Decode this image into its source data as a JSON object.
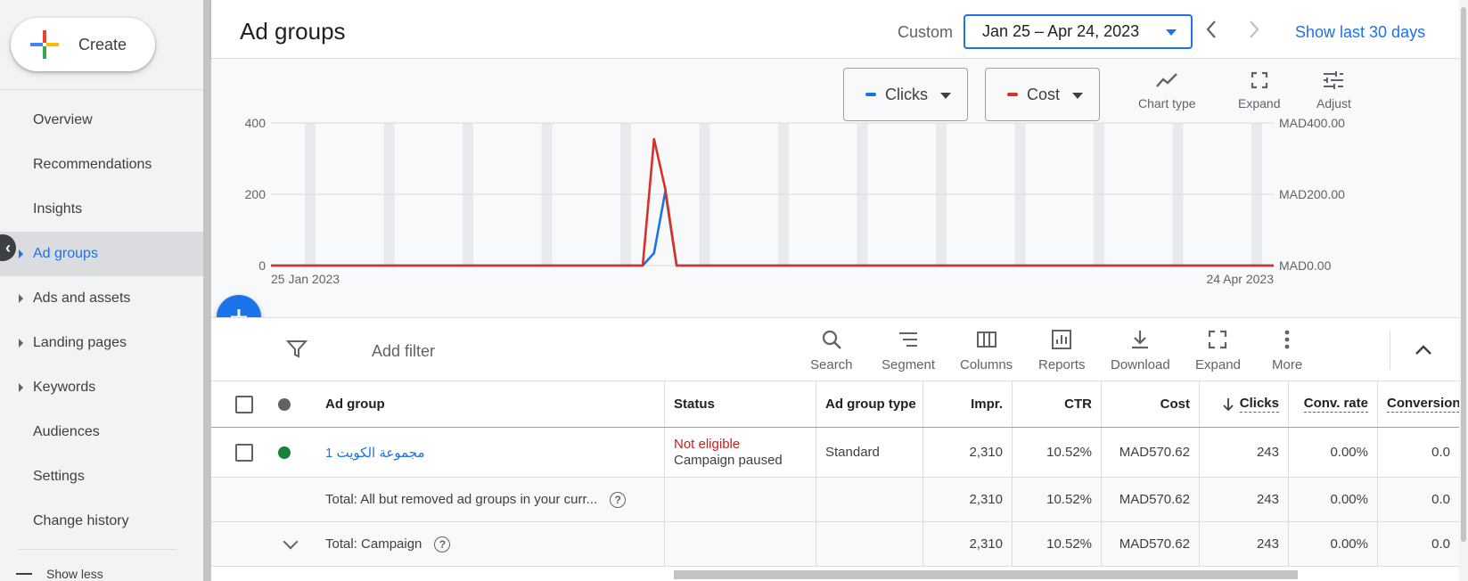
{
  "sidebar": {
    "create_label": "Create",
    "items": [
      {
        "label": "Overview",
        "expandable": false,
        "active": false
      },
      {
        "label": "Recommendations",
        "expandable": false,
        "active": false
      },
      {
        "label": "Insights",
        "expandable": false,
        "active": false
      },
      {
        "label": "Ad groups",
        "expandable": true,
        "active": true
      },
      {
        "label": "Ads and assets",
        "expandable": true,
        "active": false
      },
      {
        "label": "Landing pages",
        "expandable": true,
        "active": false
      },
      {
        "label": "Keywords",
        "expandable": true,
        "active": false
      },
      {
        "label": "Audiences",
        "expandable": false,
        "active": false
      },
      {
        "label": "Settings",
        "expandable": false,
        "active": false
      },
      {
        "label": "Change history",
        "expandable": false,
        "active": false
      }
    ],
    "show_less": "Show less"
  },
  "header": {
    "title": "Ad groups",
    "custom_label": "Custom",
    "date_range": "Jan 25 – Apr 24, 2023",
    "show_last": "Show last 30 days"
  },
  "chart_controls": {
    "metric1": "Clicks",
    "metric2": "Cost",
    "chart_type": "Chart type",
    "expand": "Expand",
    "adjust": "Adjust"
  },
  "chart_data": {
    "type": "line",
    "x_start_label": "25 Jan 2023",
    "x_end_label": "24 Apr 2023",
    "y_left_ticks": [
      "0",
      "200",
      "400"
    ],
    "y_right_ticks": [
      "MAD0.00",
      "MAD200.00",
      "MAD400.00"
    ],
    "ylim_left": [
      0,
      400
    ],
    "ylim_right": [
      0,
      400
    ],
    "series": [
      {
        "name": "Clicks",
        "color": "#1a73e8",
        "axis": "left",
        "x": [
          "2023-01-25",
          "2023-02-27",
          "2023-02-28",
          "2023-03-01",
          "2023-03-02",
          "2023-04-24"
        ],
        "y": [
          0,
          0,
          35,
          208,
          0,
          0
        ]
      },
      {
        "name": "Cost",
        "color": "#d93025",
        "axis": "right",
        "x": [
          "2023-01-25",
          "2023-02-27",
          "2023-02-28",
          "2023-03-01",
          "2023-03-02",
          "2023-04-24"
        ],
        "y": [
          0,
          0,
          355,
          215,
          0,
          0
        ]
      }
    ]
  },
  "toolbar": {
    "add_filter": "Add filter",
    "search": "Search",
    "segment": "Segment",
    "columns": "Columns",
    "reports": "Reports",
    "download": "Download",
    "expand": "Expand",
    "more": "More"
  },
  "table": {
    "headers": {
      "ad_group": "Ad group",
      "status": "Status",
      "ad_group_type": "Ad group type",
      "impr": "Impr.",
      "ctr": "CTR",
      "cost": "Cost",
      "clicks": "Clicks",
      "conv_rate": "Conv. rate",
      "conversions": "Conversions"
    },
    "row": {
      "status_color": "#188038",
      "ad_group": "مجموعة الكويت 1",
      "status_main": "Not eligible",
      "status_sub": "Campaign paused",
      "ad_group_type": "Standard",
      "impr": "2,310",
      "ctr": "10.52%",
      "cost": "MAD570.62",
      "clicks": "243",
      "conv_rate": "0.00%",
      "conversions": "0.0"
    },
    "total1": {
      "label": "Total: All but removed ad groups in your curr...",
      "impr": "2,310",
      "ctr": "10.52%",
      "cost": "MAD570.62",
      "clicks": "243",
      "conv_rate": "0.00%",
      "conversions": "0.0"
    },
    "total2": {
      "label": "Total: Campaign",
      "impr": "2,310",
      "ctr": "10.52%",
      "cost": "MAD570.62",
      "clicks": "243",
      "conv_rate": "0.00%",
      "conversions": "0.0"
    }
  }
}
